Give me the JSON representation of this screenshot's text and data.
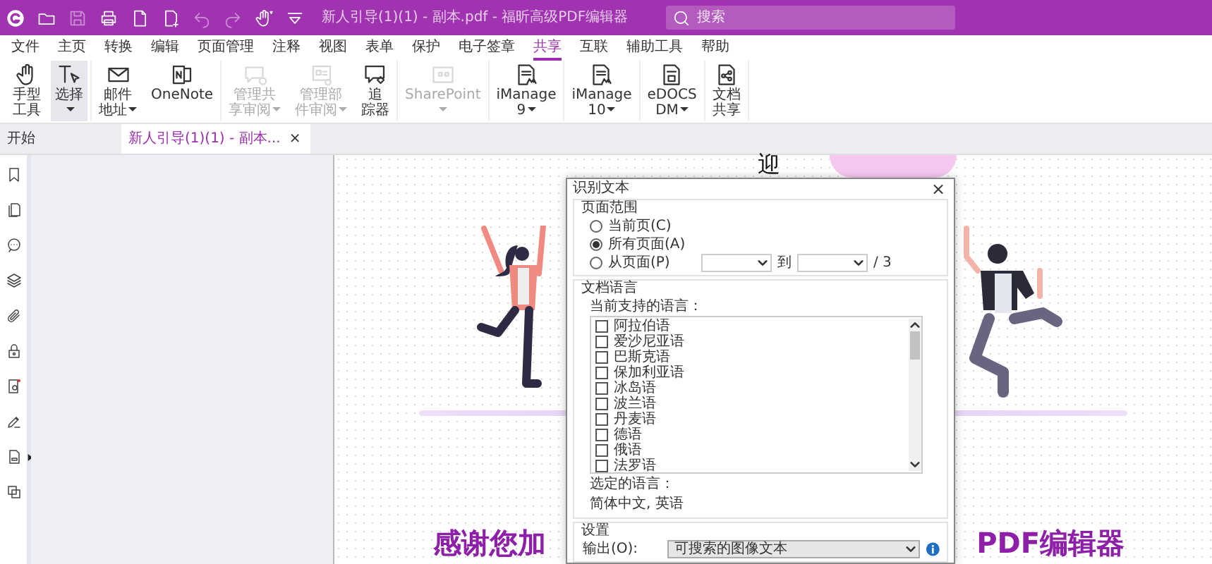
{
  "title_bar": {
    "quick_access": [
      {
        "kind": "folder",
        "disabled": false
      },
      {
        "kind": "save",
        "disabled": true
      },
      {
        "kind": "print",
        "disabled": false
      },
      {
        "kind": "file",
        "disabled": false
      },
      {
        "kind": "file-add",
        "disabled": false
      },
      {
        "kind": "undo",
        "disabled": true
      },
      {
        "kind": "redo",
        "disabled": true
      },
      {
        "kind": "hand",
        "disabled": false
      },
      {
        "kind": "customize",
        "disabled": false
      }
    ],
    "title": "新人引导(1)(1) - 副本.pdf - 福昕高级PDF编辑器",
    "search": {
      "placeholder": "搜索"
    }
  },
  "menu": [
    {
      "label": "文件",
      "selected": false
    },
    {
      "label": "主页",
      "selected": false
    },
    {
      "label": "转换",
      "selected": false
    },
    {
      "label": "编辑",
      "selected": false
    },
    {
      "label": "页面管理",
      "selected": false
    },
    {
      "label": "注释",
      "selected": false
    },
    {
      "label": "视图",
      "selected": false
    },
    {
      "label": "表单",
      "selected": false
    },
    {
      "label": "保护",
      "selected": false
    },
    {
      "label": "电子签章",
      "selected": false
    },
    {
      "label": "共享",
      "selected": true
    },
    {
      "label": "互联",
      "selected": false
    },
    {
      "label": "辅助工具",
      "selected": false
    },
    {
      "label": "帮助",
      "selected": false
    }
  ],
  "ribbon": {
    "groups": [
      {
        "items": [
          {
            "kind": "hand",
            "lines": [
              "手型",
              "工具"
            ],
            "dropdown": false,
            "disabled": false,
            "selected": false
          },
          {
            "kind": "select",
            "lines": [
              "选择"
            ],
            "dropdown": true,
            "disabled": false,
            "selected": true
          }
        ]
      },
      {
        "items": [
          {
            "kind": "mail",
            "lines": [
              "邮件",
              "地址"
            ],
            "dropdown": true,
            "disabled": false,
            "selected": false
          },
          {
            "kind": "onenote",
            "lines": [
              "OneNote"
            ],
            "dropdown": false,
            "disabled": false,
            "selected": false
          }
        ]
      },
      {
        "items": [
          {
            "kind": "review",
            "lines": [
              "管理共",
              "享审阅"
            ],
            "dropdown": true,
            "disabled": true,
            "selected": false
          },
          {
            "kind": "doc-review",
            "lines": [
              "管理部",
              "件审阅"
            ],
            "dropdown": true,
            "disabled": true,
            "selected": false
          },
          {
            "kind": "tracker",
            "lines": [
              "追",
              "踪器"
            ],
            "dropdown": false,
            "disabled": false,
            "selected": false
          }
        ]
      },
      {
        "items": [
          {
            "kind": "sharepoint",
            "lines": [
              "SharePoint"
            ],
            "dropdown": true,
            "disabled": true,
            "selected": false
          }
        ]
      },
      {
        "items": [
          {
            "kind": "imanage",
            "lines": [
              "iManage",
              "9"
            ],
            "dropdown": true,
            "disabled": false,
            "selected": false
          }
        ]
      },
      {
        "items": [
          {
            "kind": "imanage",
            "lines": [
              "iManage",
              "10"
            ],
            "dropdown": true,
            "disabled": false,
            "selected": false
          }
        ]
      },
      {
        "items": [
          {
            "kind": "edocs",
            "lines": [
              "eDOCS",
              "DM"
            ],
            "dropdown": true,
            "disabled": false,
            "selected": false
          }
        ]
      },
      {
        "items": [
          {
            "kind": "share-doc",
            "lines": [
              "文档",
              "共享"
            ],
            "dropdown": false,
            "disabled": false,
            "selected": false
          }
        ]
      }
    ]
  },
  "doc_tabs": [
    {
      "label": "开始",
      "selected": false
    },
    {
      "label": "新人引导(1)(1) - 副本...",
      "selected": true,
      "close": "×"
    }
  ],
  "document": {
    "heading_fragment": "迎",
    "headline_left": "感谢您加",
    "headline_right": "PDF编辑器"
  },
  "dialog": {
    "title": "识别文本",
    "close": "×",
    "page_range": {
      "legend": "页面范围",
      "options": [
        {
          "label": "当前页(C)",
          "selected": false
        },
        {
          "label": "所有页面(A)",
          "selected": true
        },
        {
          "label": "从页面(P)",
          "selected": false
        }
      ],
      "to_label": "到",
      "total": "/ 3"
    },
    "language": {
      "legend": "文档语言",
      "list_label": "当前支持的语言：",
      "languages": [
        {
          "label": "阿拉伯语",
          "checked": false
        },
        {
          "label": "爱沙尼亚语",
          "checked": false
        },
        {
          "label": "巴斯克语",
          "checked": false
        },
        {
          "label": "保加利亚语",
          "checked": false
        },
        {
          "label": "冰岛语",
          "checked": false
        },
        {
          "label": "波兰语",
          "checked": false
        },
        {
          "label": "丹麦语",
          "checked": false
        },
        {
          "label": "德语",
          "checked": false
        },
        {
          "label": "俄语",
          "checked": false
        },
        {
          "label": "法罗语",
          "checked": false
        }
      ],
      "selected_label": "选定的语言：",
      "selected_value": "简体中文, 英语"
    },
    "settings": {
      "legend": "设置",
      "output_label": "输出(O):",
      "output_value": "可搜索的图像文本"
    }
  }
}
